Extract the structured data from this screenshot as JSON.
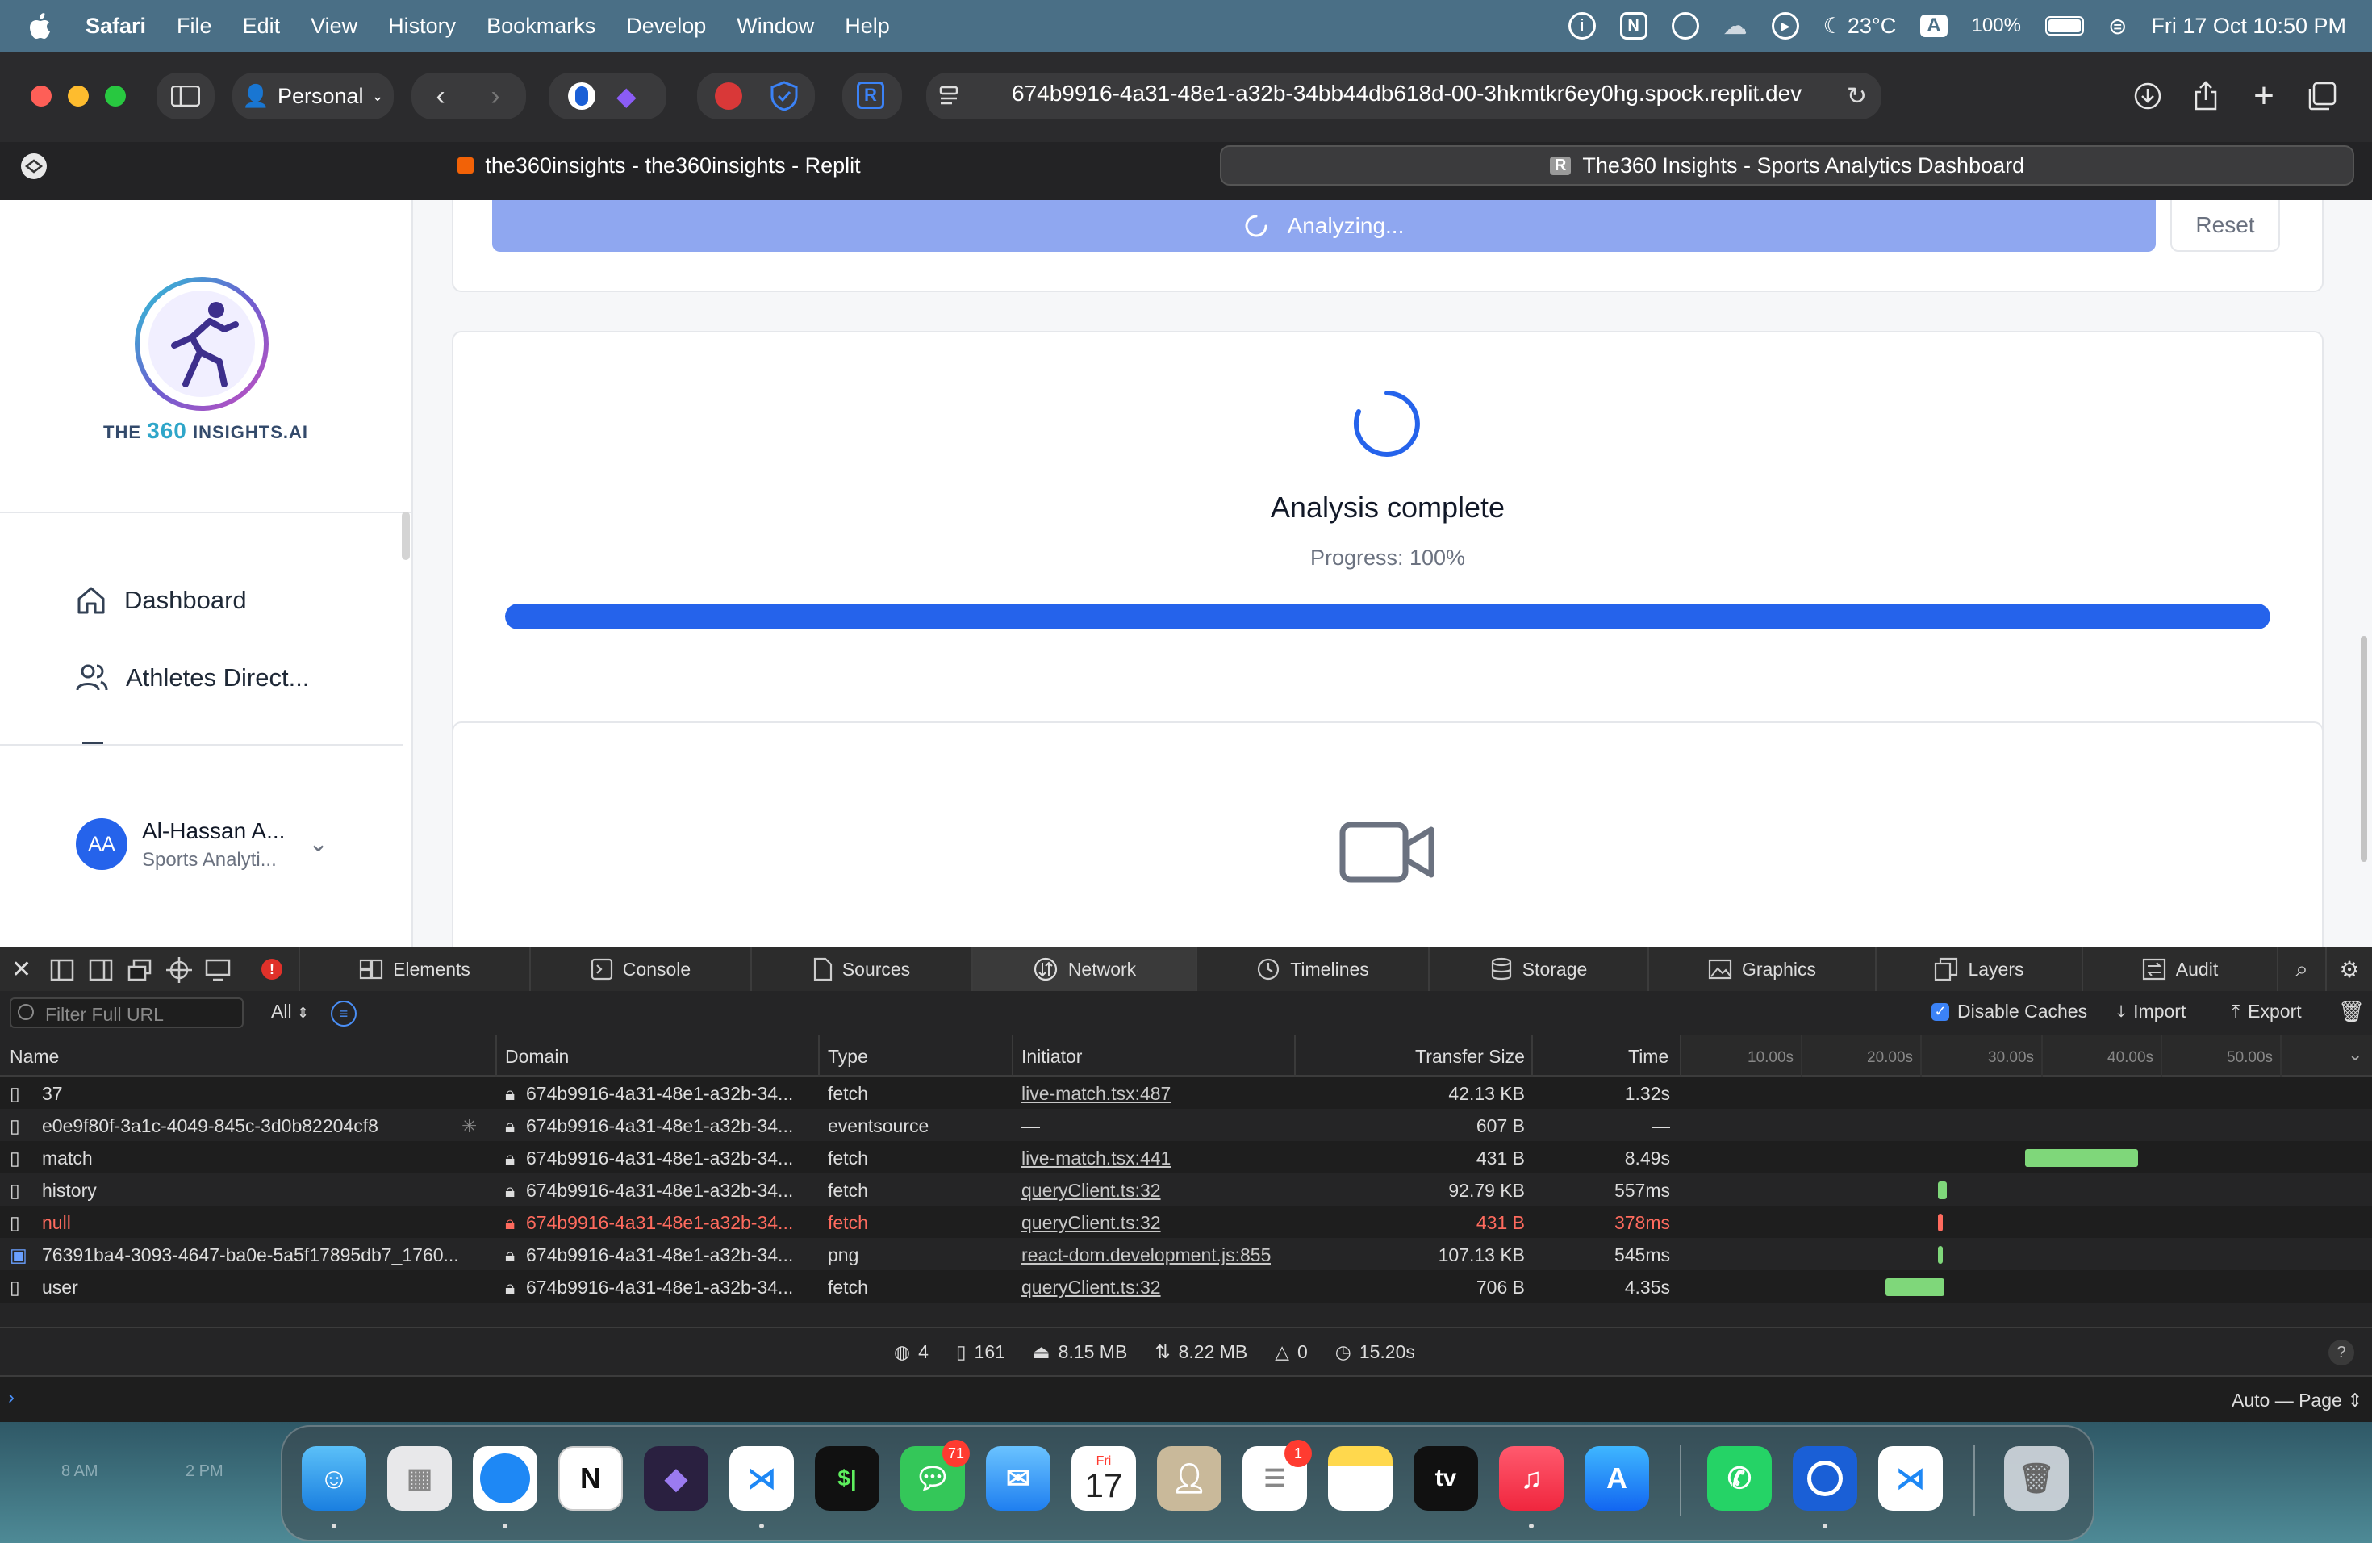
{
  "menubar": {
    "app": "Safari",
    "items": [
      "File",
      "Edit",
      "View",
      "History",
      "Bookmarks",
      "Develop",
      "Window",
      "Help"
    ],
    "weather": "23°C",
    "input_source": "A",
    "battery": "100%",
    "datetime": "Fri 17 Oct  10:50 PM"
  },
  "safari": {
    "profile": "Personal",
    "url": "674b9916-4a31-48e1-a32b-34bb44db618d-00-3hkmtkr6ey0hg.spock.replit.dev",
    "tabs": [
      {
        "title": "the360insights - the360insights - Replit",
        "icon": "replit-icon",
        "active": false
      },
      {
        "title": "The360 Insights - Sports Analytics Dashboard",
        "icon": "R",
        "active": true
      }
    ]
  },
  "app": {
    "logo_text_prefix": "THE ",
    "logo_text_highlight": "360",
    "logo_text_suffix": " INSIGHTS.AI",
    "nav": [
      {
        "label": "Dashboard",
        "icon": "home-icon"
      },
      {
        "label": "Athletes Direct...",
        "icon": "users-icon"
      }
    ],
    "user": {
      "initials": "AA",
      "name": "Al-Hassan A...",
      "role": "Sports Analyti..."
    },
    "analyze_button": "Analyzing...",
    "reset_button": "Reset",
    "status_title": "Analysis complete",
    "progress_text": "Progress: 100%",
    "progress_value": 1.0,
    "empty_icon": "video-camera-icon"
  },
  "devtools": {
    "tabs": [
      {
        "label": "Elements",
        "icon": "elements-icon"
      },
      {
        "label": "Console",
        "icon": "console-icon"
      },
      {
        "label": "Sources",
        "icon": "sources-icon"
      },
      {
        "label": "Network",
        "icon": "network-icon",
        "active": true
      },
      {
        "label": "Timelines",
        "icon": "timelines-icon"
      },
      {
        "label": "Storage",
        "icon": "storage-icon"
      },
      {
        "label": "Graphics",
        "icon": "graphics-icon"
      },
      {
        "label": "Layers",
        "icon": "layers-icon"
      },
      {
        "label": "Audit",
        "icon": "audit-icon"
      }
    ],
    "filter_placeholder": "Filter Full URL",
    "type_filter": "All",
    "disable_caches": "Disable Caches",
    "import": "Import",
    "export": "Export",
    "columns": [
      "Name",
      "Domain",
      "Type",
      "Initiator",
      "Transfer Size",
      "Time"
    ],
    "timeline_ticks": [
      "10.00s",
      "20.00s",
      "30.00s",
      "40.00s",
      "50.00s"
    ],
    "rows": [
      {
        "name": "37",
        "domain": "674b9916-4a31-48e1-a32b-34...",
        "type": "fetch",
        "initiator": "live-match.tsx:487",
        "size": "42.13 KB",
        "time": "1.32s",
        "error": false,
        "bar_start": 0.993,
        "bar_len": 0.016
      },
      {
        "name": "e0e9f80f-3a1c-4049-845c-3d0b82204cf8",
        "domain": "674b9916-4a31-48e1-a32b-34...",
        "type": "eventsource",
        "initiator": "—",
        "size": "607 B",
        "time": "—",
        "error": false,
        "bar_start": null,
        "bar_len": null
      },
      {
        "name": "match",
        "domain": "674b9916-4a31-48e1-a32b-34...",
        "type": "fetch",
        "initiator": "live-match.tsx:441",
        "size": "431 B",
        "time": "8.49s",
        "error": false,
        "bar_start": 0.498,
        "bar_len": 0.163
      },
      {
        "name": "history",
        "domain": "674b9916-4a31-48e1-a32b-34...",
        "type": "fetch",
        "initiator": "queryClient.ts:32",
        "size": "92.79 KB",
        "time": "557ms",
        "error": false,
        "bar_start": 0.372,
        "bar_len": 0.012
      },
      {
        "name": "null",
        "domain": "674b9916-4a31-48e1-a32b-34...",
        "type": "fetch",
        "initiator": "queryClient.ts:32",
        "size": "431 B",
        "time": "378ms",
        "error": true,
        "bar_start": 0.372,
        "bar_len": 0.005
      },
      {
        "name": "76391ba4-3093-4647-ba0e-5a5f17895db7_1760...",
        "domain": "674b9916-4a31-48e1-a32b-34...",
        "type": "png",
        "initiator": "react-dom.development.js:855",
        "size": "107.13 KB",
        "time": "545ms",
        "error": false,
        "bar_start": 0.372,
        "bar_len": 0.006
      },
      {
        "name": "user",
        "domain": "674b9916-4a31-48e1-a32b-34...",
        "type": "fetch",
        "initiator": "queryClient.ts:32",
        "size": "706 B",
        "time": "4.35s",
        "error": false,
        "bar_start": 0.296,
        "bar_len": 0.085
      }
    ],
    "status": {
      "domains": "4",
      "requests": "161",
      "resources": "8.15 MB",
      "transferred": "8.22 MB",
      "errors": "0",
      "time": "15.20s"
    },
    "console_mode": "Auto — Page"
  },
  "dock": {
    "apps": [
      "Finder",
      "Launchpad",
      "Safari",
      "Notion",
      "Obsidian",
      "VS Code",
      "Terminal",
      "Messages",
      "Mail",
      "Calendar",
      "Contacts",
      "Reminders",
      "Notes",
      "TV",
      "Music",
      "App Store",
      "WhatsApp",
      "1Password",
      "VS Code Insiders",
      "Trash"
    ],
    "messages_badge": "71",
    "reminders_badge": "1",
    "calendar_day": "17",
    "calendar_weekday": "Fri",
    "terminal_label": "$|",
    "tv_label": "tv",
    "widget_times": [
      "8 AM",
      "2 PM"
    ]
  },
  "colors": {
    "accent": "#2563eb",
    "button_loading": "#8fa7f0",
    "progress_track": "#dbe4fb",
    "error_text": "#ff6b5e",
    "timeline_bar": "#7fd77a"
  }
}
